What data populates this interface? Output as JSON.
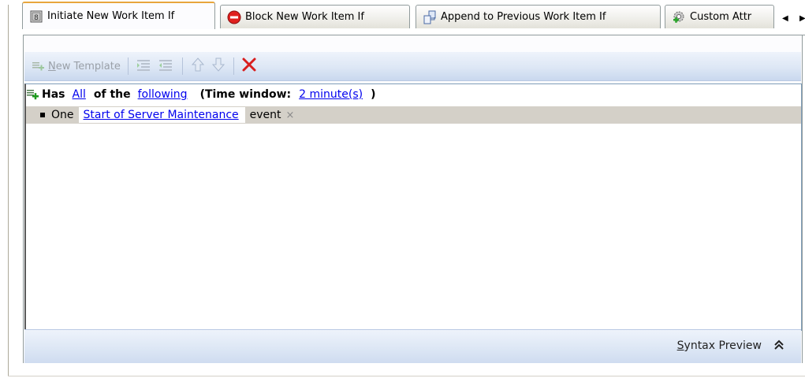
{
  "tabs": [
    {
      "label": "Initiate New Work Item If",
      "icon": "rule-doc-icon",
      "active": true
    },
    {
      "label": "Block New Work Item If",
      "icon": "block-circle-icon",
      "active": false
    },
    {
      "label": "Append to Previous Work Item If",
      "icon": "append-docs-icon",
      "active": false
    },
    {
      "label": "Custom Attr",
      "icon": "gear-plus-icon",
      "active": false
    }
  ],
  "toolbar": {
    "new_template_prefix": "N",
    "new_template_rest": "ew Template",
    "icons": [
      "indent-increase-icon",
      "indent-decrease-icon",
      "move-up-icon",
      "move-down-icon",
      "delete-icon"
    ]
  },
  "editor": {
    "has": "Has",
    "all": "All",
    "of_the": "of the",
    "following": "following",
    "time_window_label": "(Time window:",
    "time_window_value": "2 minute(s)",
    "close_paren": ")",
    "item_count": "One",
    "item_event_name": "Start of Server Maintenance",
    "item_suffix": "event",
    "remove_glyph": "×"
  },
  "syntax": {
    "label_prefix": "S",
    "label_rest": "yntax Preview",
    "chevron": "double-up-chevron-icon"
  },
  "colors": {
    "link": "#0000ee",
    "delete_red": "#d81e1e",
    "toolbar_blue": "#dde7f5"
  }
}
